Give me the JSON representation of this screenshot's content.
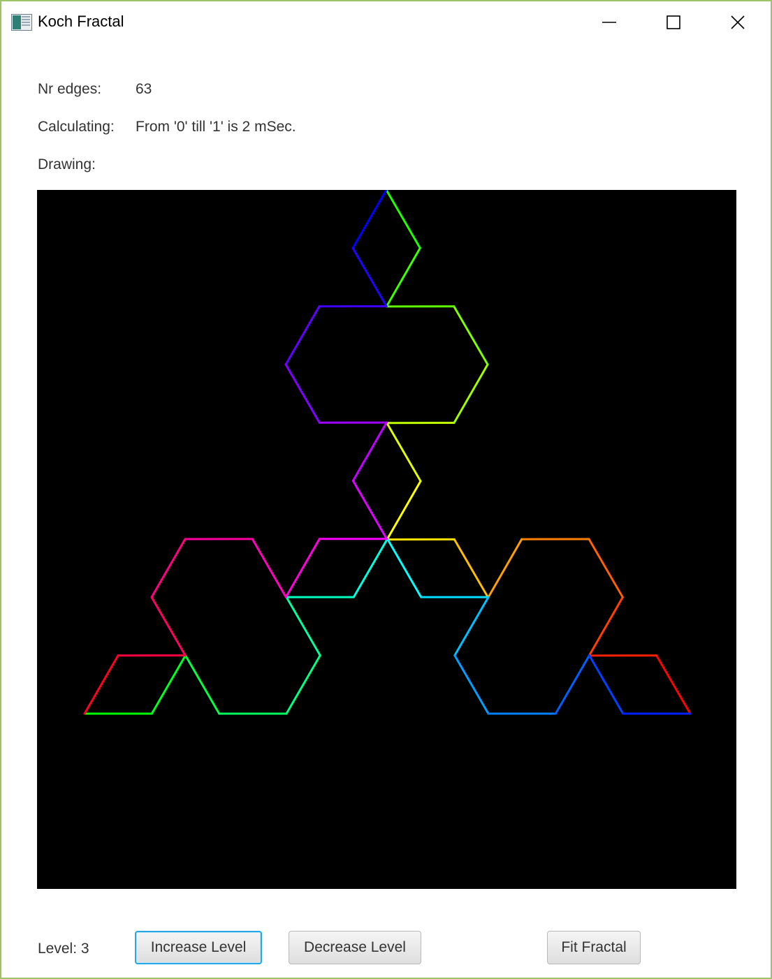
{
  "window": {
    "title": "Koch Fractal",
    "icon": "java-app-icon",
    "controls": [
      "minimize-icon",
      "maximize-icon",
      "close-icon"
    ]
  },
  "info": {
    "edges_label": "Nr edges:",
    "edges_value": "63",
    "calculating_label": "Calculating:",
    "calculating_value": "From '0' till '1' is 2 mSec.",
    "drawing_label": "Drawing:",
    "drawing_value": ""
  },
  "canvas": {
    "background": "#000000",
    "fractal_level": 3,
    "edge_count": 63,
    "coloring": "hue rainbow along edges"
  },
  "footer": {
    "level_label": "Level: 3",
    "increase_label": "Increase Level",
    "decrease_label": "Decrease Level",
    "fit_label": "Fit Fractal"
  },
  "colors": {
    "window_border": "#9ec46a",
    "focus_ring": "#28a7e6"
  }
}
